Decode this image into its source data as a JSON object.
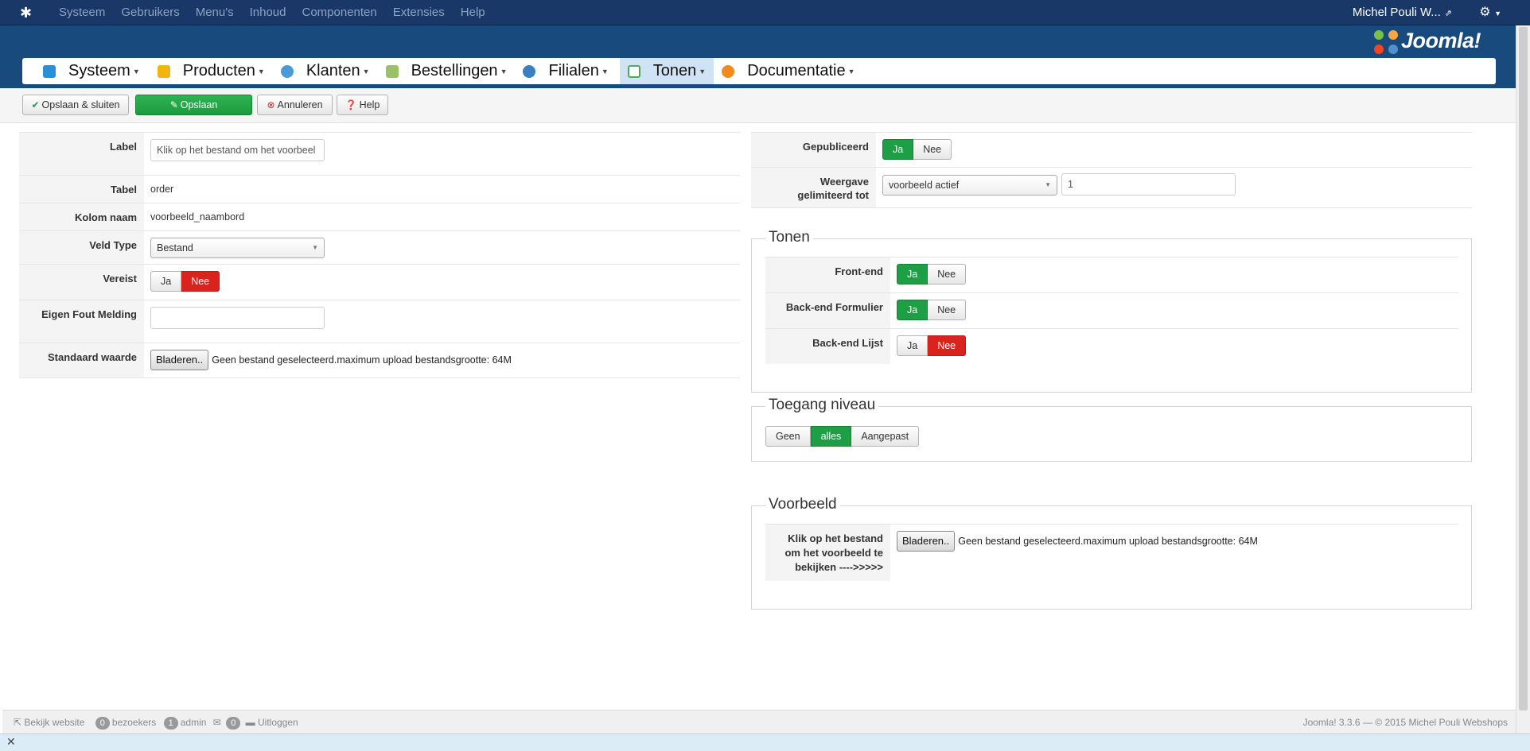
{
  "topbar": {
    "menu": [
      "Systeem",
      "Gebruikers",
      "Menu's",
      "Inhoud",
      "Componenten",
      "Extensies",
      "Help"
    ],
    "user": "Michel Pouli W...",
    "gear_icon": "gear-icon"
  },
  "brand": "Joomla!",
  "compnav": {
    "items": [
      {
        "label": "Systeem",
        "icon": "tools-icon",
        "color": "#2a8fd6"
      },
      {
        "label": "Producten",
        "icon": "box-icon",
        "color": "#f3b311"
      },
      {
        "label": "Klanten",
        "icon": "users-icon",
        "color": "#4a9ad8"
      },
      {
        "label": "Bestellingen",
        "icon": "orders-icon",
        "color": "#9bc06a"
      },
      {
        "label": "Filialen",
        "icon": "store-icon",
        "color": "#3a7fc1"
      },
      {
        "label": "Tonen",
        "icon": "window-icon",
        "color": "#4fa95a"
      },
      {
        "label": "Documentatie",
        "icon": "docs-icon",
        "color": "#f08a1c"
      }
    ]
  },
  "toolbar": {
    "save_close": "Opslaan & sluiten",
    "save": "Opslaan",
    "cancel": "Annuleren",
    "help": "Help"
  },
  "form_left": {
    "label_label": "Label",
    "label_value": "Klik op het bestand om het voorbeel",
    "tabel_label": "Tabel",
    "tabel_value": "order",
    "kolom_label": "Kolom naam",
    "kolom_value": "voorbeeld_naambord",
    "veldtype_label": "Veld Type",
    "veldtype_value": "Bestand",
    "vereist_label": "Vereist",
    "vereist_yes": "Ja",
    "vereist_no": "Nee",
    "fout_label": "Eigen Fout Melding",
    "fout_value": "",
    "standaard_label": "Standaard waarde",
    "browse": "Bladeren..",
    "no_file": "Geen bestand geselecteerd.",
    "max_upload": "maximum upload bestandsgrootte: 64M"
  },
  "form_right": {
    "gepubliceerd_label": "Gepubliceerd",
    "yes": "Ja",
    "no": "Nee",
    "weergave_label_1": "Weergave",
    "weergave_label_2": "gelimiteerd tot",
    "weergave_select": "voorbeeld actief",
    "weergave_input": "1"
  },
  "tonen": {
    "legend": "Tonen",
    "frontend_label": "Front-end",
    "backend_form_label": "Back-end Formulier",
    "backend_list_label": "Back-end Lijst",
    "yes": "Ja",
    "no": "Nee"
  },
  "toegang": {
    "legend": "Toegang niveau",
    "options": [
      "Geen",
      "alles",
      "Aangepast"
    ]
  },
  "voorbeeld": {
    "legend": "Voorbeeld",
    "label_1": "Klik op het bestand",
    "label_2": "om het voorbeeld te",
    "label_3": "bekijken ---->>>>>",
    "browse": "Bladeren..",
    "no_file": "Geen bestand geselecteerd.",
    "max_upload": "maximum upload bestandsgrootte: 64M"
  },
  "footer": {
    "view_site": "Bekijk website",
    "visitors_count": "0",
    "visitors": "bezoekers",
    "admin_count": "1",
    "admin": "admin",
    "msg_count": "0",
    "logout": "Uitloggen",
    "version": "Joomla! 3.3.6",
    "copyright": "© 2015 Michel Pouli Webshops"
  },
  "colors": {
    "green": "#1e9e45",
    "red": "#d9231c",
    "header": "#184a7d",
    "topbar": "#1a3867"
  }
}
